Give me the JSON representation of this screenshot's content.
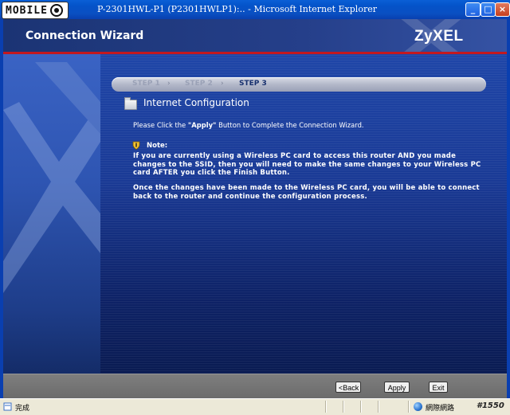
{
  "window": {
    "logo_text": "MOBILE",
    "title": "P-2301HWL-P1 (P2301HWLP1):.. - Microsoft Internet Explorer",
    "controls": {
      "minimize": "_",
      "maximize": "□",
      "close": "×"
    }
  },
  "header": {
    "title": "Connection Wizard",
    "brand": "ZyXEL"
  },
  "steps": {
    "step1": "STEP 1",
    "step2": "STEP 2",
    "step3": "STEP 3",
    "separator": "›",
    "current": "STEP 3"
  },
  "section": {
    "title": "Internet Configuration"
  },
  "instruction": {
    "prefix": "Please Click the ",
    "emphasis": "\"Apply\"",
    "suffix": " Button to Complete the Connection Wizard."
  },
  "note": {
    "label": "Note:",
    "paragraph1": "If you are currently using a Wireless PC card to access this router AND you made changes to the SSID, then you will need to make the same changes to your Wireless PC card AFTER you click the Finish Button.",
    "paragraph2": "Once the changes have been made to the Wireless PC card, you will be able to connect back to the router and continue the configuration process."
  },
  "footer": {
    "back_label": "<Back",
    "apply_label": "Apply",
    "exit_label": "Exit"
  },
  "statusbar": {
    "status": "完成",
    "zone": "網際網路",
    "watermark": "#1550"
  },
  "colors": {
    "header_bg": "#253f8a",
    "accent_red": "#c2181f",
    "content_bg": "#1a3a95",
    "titlebar": "#0453c9"
  }
}
